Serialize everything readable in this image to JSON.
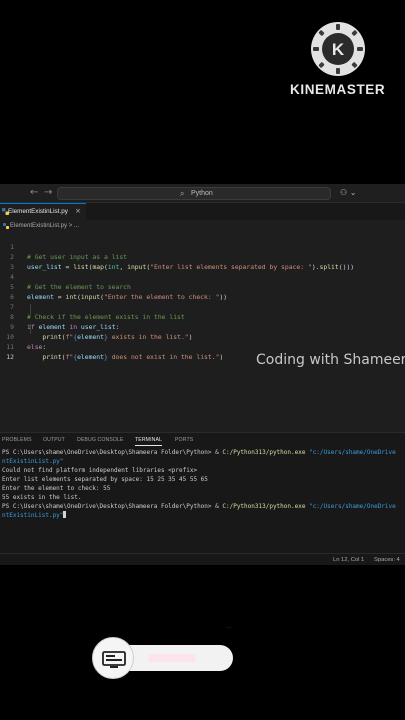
{
  "watermark": {
    "brand": "KINEMASTER",
    "logo_letter": "K"
  },
  "overlay": {
    "caption": "Coding with Shameera"
  },
  "titlebar": {
    "back_icon": "←",
    "forward_icon": "→",
    "search_label": "Python",
    "copilot_icon": "⚇ ⌄"
  },
  "tab": {
    "filename": "ElementExistinList.py",
    "close_icon": "×"
  },
  "breadcrumb": {
    "text": "ElementExistinList.py > ..."
  },
  "editor": {
    "line_numbers": [
      "1",
      "2",
      "3",
      "4",
      "5",
      "6",
      "7",
      "8",
      "9",
      "10",
      "11",
      "12"
    ],
    "lines": [
      "# Get user input as a list",
      "user_list = list(map(int, input(\"Enter list elements separated by space: \").split()))",
      "",
      "# Get the element to search",
      "element = int(input(\"Enter the element to check: \"))",
      "",
      "# Check if the element exists in the list",
      "if element in user_list:",
      "    print(f\"{element} exists in the list.\")",
      "else:",
      "    print(f\"{element} does not exist in the list.\")",
      ""
    ]
  },
  "panel": {
    "tabs": [
      "PROBLEMS",
      "OUTPUT",
      "DEBUG CONSOLE",
      "TERMINAL",
      "PORTS"
    ],
    "active_tab": "TERMINAL",
    "terminal": {
      "prompt1": "PS C:\\Users\\shame\\OneDrive\\Desktop\\Shameera Folder\\Python> ",
      "cmd1_amp": "& ",
      "cmd1_exe": "C:/Python313/python.exe ",
      "cmd1_arg": "\"c:/Users/shame/OneDrive",
      "cmd1_arg_wrap": "ntExistinList.py\"",
      "out1": "Could not find platform independent libraries <prefix>",
      "out2": "Enter list elements separated by space: 15 25 35 45 55 65",
      "out3": "Enter the element to check: 55",
      "out4": "55 exists in the list.",
      "prompt2": "PS C:\\Users\\shame\\OneDrive\\Desktop\\Shameera Folder\\Python> ",
      "cmd2_amp": "& ",
      "cmd2_exe": "C:/Python313/python.exe ",
      "cmd2_arg": "\"c:/Users/shame/OneDrive",
      "cmd2_arg_wrap": "ntExistinList.py\""
    }
  },
  "statusbar": {
    "position": "Ln 12, Col 1",
    "spaces": "Spaces: 4"
  },
  "recorder": {
    "tiny_label": "...."
  }
}
